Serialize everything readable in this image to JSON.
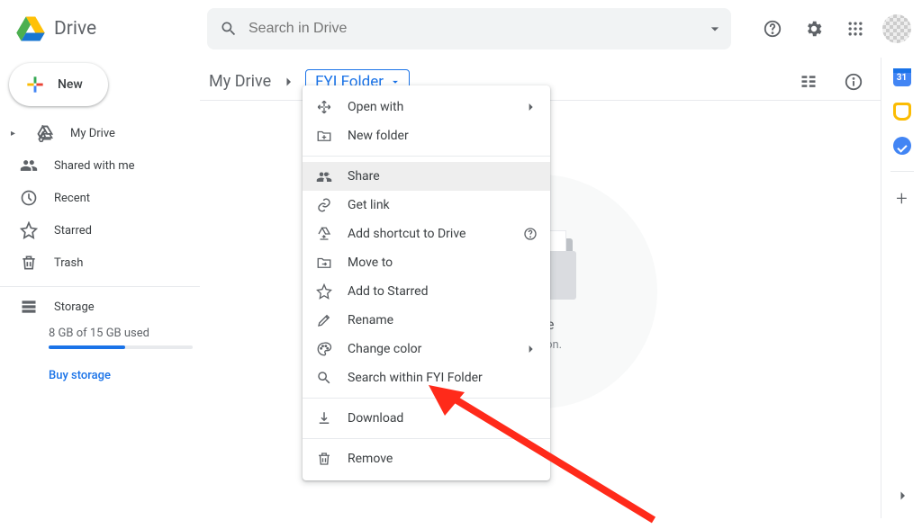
{
  "app": {
    "name": "Drive"
  },
  "search": {
    "placeholder": "Search in Drive"
  },
  "sidebar": {
    "new_label": "New",
    "items": [
      {
        "label": "My Drive"
      },
      {
        "label": "Shared with me"
      },
      {
        "label": "Recent"
      },
      {
        "label": "Starred"
      },
      {
        "label": "Trash"
      }
    ],
    "storage_label": "Storage",
    "storage_used": "8 GB of 15 GB used",
    "buy_label": "Buy storage"
  },
  "breadcrumb": {
    "root": "My Drive",
    "current": "FYI Folder"
  },
  "empty": {
    "title_suffix": "here",
    "subtitle_suffix": "\" button."
  },
  "sidepanel": {
    "cal_day": "31"
  },
  "menu": {
    "open_with": "Open with",
    "new_folder": "New folder",
    "share": "Share",
    "get_link": "Get link",
    "add_shortcut": "Add shortcut to Drive",
    "move_to": "Move to",
    "add_starred": "Add to Starred",
    "rename": "Rename",
    "change_color": "Change color",
    "search_within": "Search within FYI Folder",
    "download": "Download",
    "remove": "Remove"
  }
}
